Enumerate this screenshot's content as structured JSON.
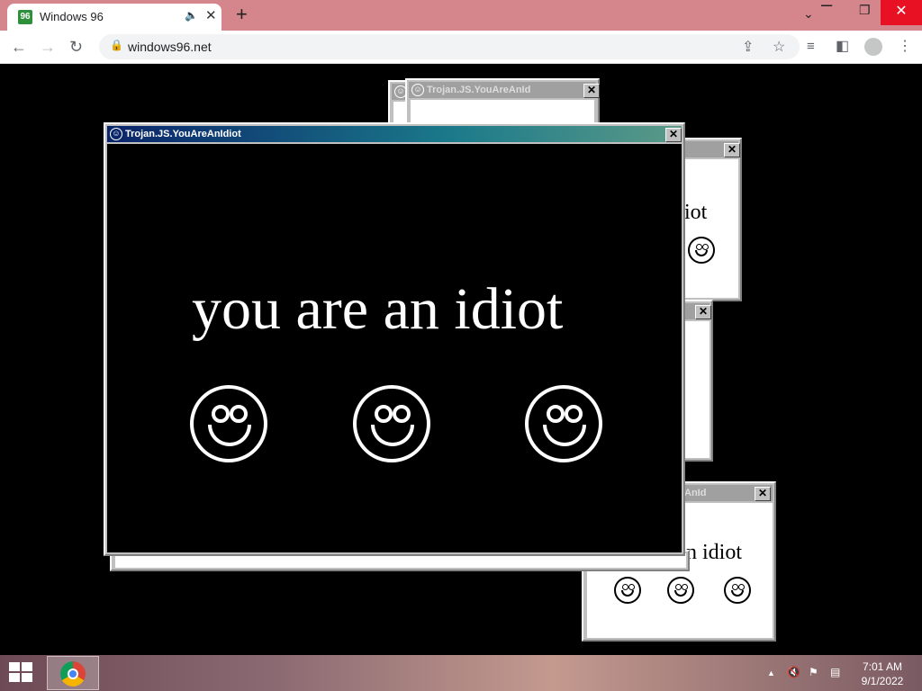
{
  "browser": {
    "tab_title": "Windows 96",
    "favicon_glyph": "96",
    "new_tab": "+",
    "url": "windows96.net",
    "minimize": "⌄",
    "restore": "❐",
    "close": "✕"
  },
  "windows": {
    "title": "Trojan.JS.YouAreAnIdiot",
    "partial_title": "Trojan.JS.YouAreAnId",
    "partial_title_2": "AnId",
    "main_text": "you are an idiot",
    "partial_text": "iot",
    "partial_text_2": "n idiot",
    "close_glyph": "✕"
  },
  "taskbar": {
    "time": "7:01 AM",
    "date": "9/1/2022",
    "tray_arrow": "▲"
  },
  "colors": {
    "tabbar": "#d5868c",
    "close_red": "#e81123",
    "title_active_start": "#0a246a",
    "title_active_end": "#5b9a88"
  }
}
